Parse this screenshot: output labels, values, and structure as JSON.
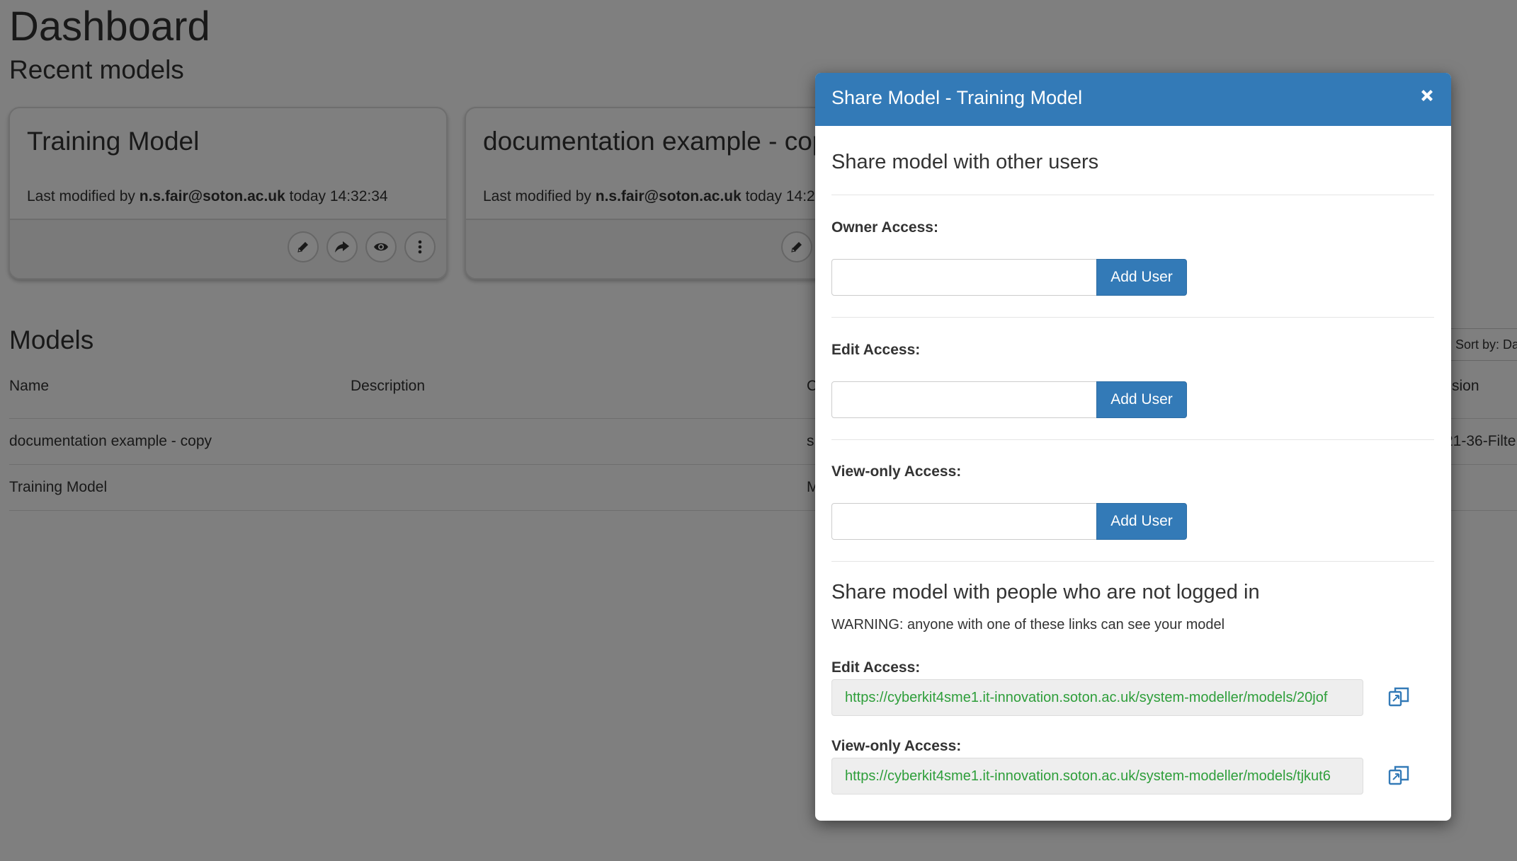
{
  "page": {
    "title": "Dashboard",
    "recent_heading": "Recent models"
  },
  "recent_models": [
    {
      "name": "Training Model",
      "meta_prefix": "Last modified by",
      "user": "n.s.fair@soton.ac.uk",
      "meta_suffix": "today 14:32:34"
    },
    {
      "name": "documentation example - copy",
      "meta_prefix": "Last modified by",
      "user": "n.s.fair@soton.ac.uk",
      "meta_suffix": "today 14:2"
    }
  ],
  "models": {
    "heading": "Models",
    "sort_label": "Sort by: Da",
    "columns": [
      "Name",
      "Description",
      "C",
      "sion"
    ],
    "rows": [
      {
        "name": "documentation example - copy",
        "col3": "s",
        "col4": "21-36-Filte"
      },
      {
        "name": "Training Model",
        "col3": "M",
        "col4": ""
      }
    ]
  },
  "modal": {
    "title": "Share Model - Training Model",
    "section_users": "Share model with other users",
    "owner_label": "Owner Access:",
    "edit_label": "Edit Access:",
    "view_label": "View-only Access:",
    "add_user_label": "Add User",
    "section_public": "Share model with people who are not logged in",
    "warning": "WARNING: anyone with one of these links can see your model",
    "edit_link_label": "Edit Access:",
    "edit_link": "https://cyberkit4sme1.it-innovation.soton.ac.uk/system-modeller/models/20jof",
    "view_link_label": "View-only Access:",
    "view_link": "https://cyberkit4sme1.it-innovation.soton.ac.uk/system-modeller/models/tjkut6"
  },
  "colors": {
    "primary": "#337ab7",
    "link_text": "#2e9e3a",
    "backdrop": "rgba(0,0,0,0.5)"
  }
}
